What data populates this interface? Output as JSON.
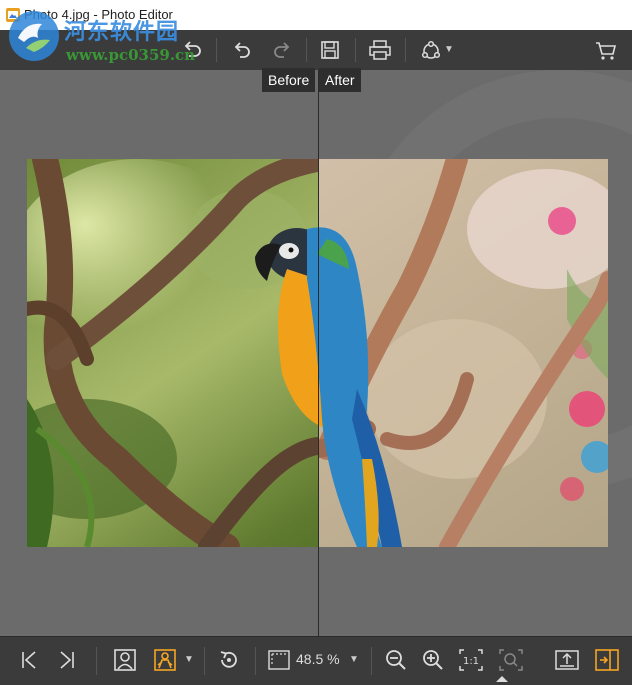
{
  "window": {
    "title": "Photo 4.jpg - Photo Editor",
    "app_icon": "photo-editor-icon"
  },
  "watermark": {
    "name": "河东软件园",
    "url": "www.pc0359.cn"
  },
  "toolbar": {
    "items": [
      "undo-all-icon",
      "undo-icon",
      "redo-icon",
      "save-icon",
      "print-icon",
      "share-icon",
      "cart-icon"
    ]
  },
  "compare": {
    "before_label": "Before",
    "after_label": "After"
  },
  "bottom_bar": {
    "zoom_value": "48.5 %",
    "icons": [
      "previous-icon",
      "next-icon",
      "portrait-icon",
      "face-detect-icon",
      "rotate-icon",
      "fit-frame-icon",
      "zoom-out-icon",
      "zoom-in-icon",
      "actual-size-icon",
      "zoom-fit-icon",
      "export-icon",
      "compare-toggle-icon"
    ]
  },
  "colors": {
    "accent": "#f5a623",
    "toolbar_bg": "#3b3b3b",
    "canvas_bg": "#6b6b6b"
  }
}
